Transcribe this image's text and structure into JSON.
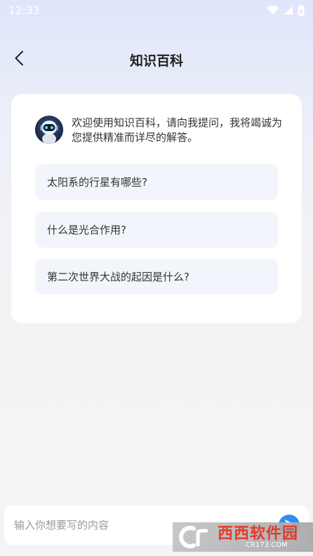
{
  "status_bar": {
    "time": "12:33",
    "icons": [
      "wifi-icon",
      "signal-icon",
      "battery-icon"
    ]
  },
  "header": {
    "title": "知识百科",
    "back_icon": "chevron-left-icon"
  },
  "chat": {
    "welcome": "欢迎使用知识百科，请向我提问，我将竭诚为您提供精准而详尽的解答。",
    "avatar_icon": "robot-avatar-icon",
    "suggestions": [
      "太阳系的行星有哪些?",
      "什么是光合作用?",
      "第二次世界大战的起因是什么?"
    ]
  },
  "composer": {
    "placeholder": "输入你想要写的内容",
    "value": "",
    "send_icon": "send-icon",
    "accent_color": "#2f8cf5"
  },
  "watermark": {
    "main": "西西软件园",
    "sub": "CR173.COM"
  }
}
